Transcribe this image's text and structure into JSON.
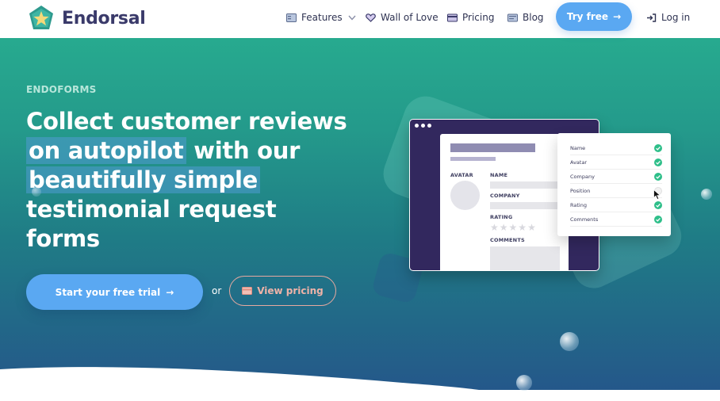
{
  "brand": {
    "name": "Endorsal"
  },
  "nav": {
    "items": [
      {
        "label": "Features",
        "icon": "features-icon"
      },
      {
        "label": "Wall of Love",
        "icon": "heart-icon"
      },
      {
        "label": "Pricing",
        "icon": "card-icon"
      },
      {
        "label": "Blog",
        "icon": "blog-icon"
      }
    ],
    "try_free": "Try free",
    "login": "Log in"
  },
  "hero": {
    "eyebrow": "ENDOFORMS",
    "headline": {
      "l1": "Collect customer reviews",
      "hl1": "on autopilot",
      "l2rest": "with our",
      "hl2": "beautifully simple",
      "l4": "testimonial request",
      "l5": "forms"
    },
    "cta_primary": "Start your free trial",
    "or": "or",
    "cta_secondary": "View pricing"
  },
  "form_preview": {
    "fields": {
      "avatar": "AVATAR",
      "name": "NAME",
      "company": "COMPANY",
      "rating": "RATING",
      "comments": "COMMENTS"
    },
    "checklist": [
      "Name",
      "Avatar",
      "Company",
      "Position",
      "Rating",
      "Comments"
    ]
  },
  "colors": {
    "accent": "#5aa8f2",
    "brand_text": "#3a3a6a",
    "check": "#2fbf8a",
    "pricing_outline": "#e6a9a0"
  }
}
